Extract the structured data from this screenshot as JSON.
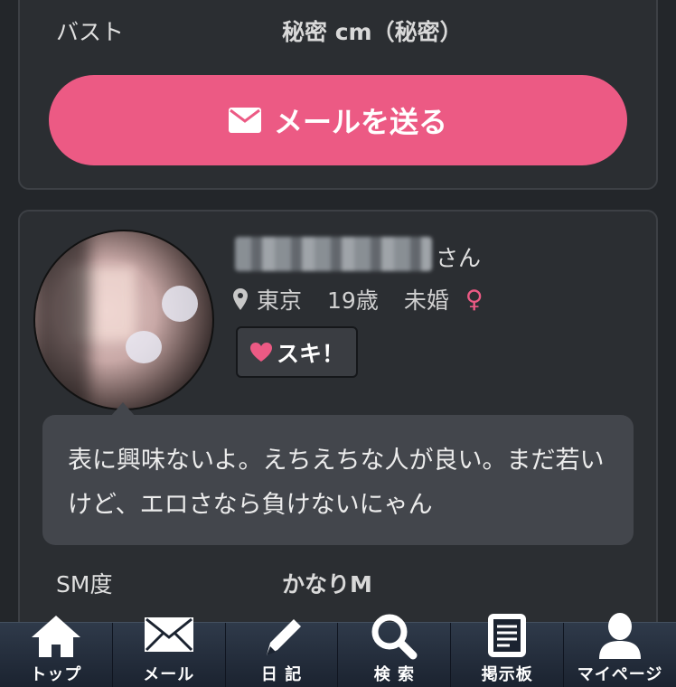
{
  "profile_top": {
    "bust_label": "バスト",
    "bust_value": "秘密 cm（秘密）",
    "mail_button": "メールを送る"
  },
  "profile": {
    "name_suffix": "さん",
    "location": "東京",
    "age": "19歳",
    "marital": "未婚",
    "gender_symbol": "♀",
    "like_button": "スキ！",
    "message": "表に興味ないよ。えちえちな人が良い。まだ若いけど、エロさなら負けないにゃん",
    "sm_label": "SM度",
    "sm_value": "かなりM"
  },
  "nav": {
    "items": [
      {
        "label": "トップ",
        "icon": "home-icon"
      },
      {
        "label": "メール",
        "icon": "mail-icon"
      },
      {
        "label": "日 記",
        "icon": "pencil-icon"
      },
      {
        "label": "検 索",
        "icon": "search-icon"
      },
      {
        "label": "掲示板",
        "icon": "board-icon"
      },
      {
        "label": "マイページ",
        "icon": "user-icon"
      }
    ]
  },
  "colors": {
    "accent": "#ec5a84",
    "background": "#23262a",
    "card": "#2b2e32",
    "bubble": "#43464c"
  }
}
